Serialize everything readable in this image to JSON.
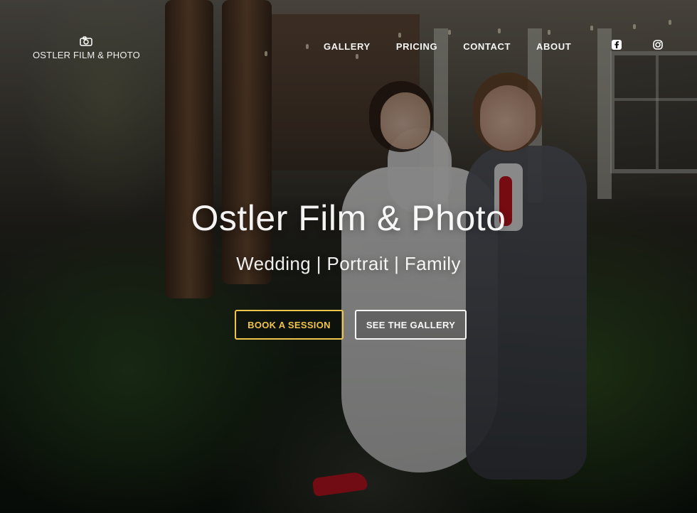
{
  "header": {
    "brand": {
      "icon": "camera-icon",
      "label": "OSTLER FILM & PHOTO"
    },
    "nav": [
      {
        "label": "GALLERY"
      },
      {
        "label": "PRICING"
      },
      {
        "label": "CONTACT"
      },
      {
        "label": "ABOUT"
      }
    ],
    "social": [
      {
        "icon": "facebook-icon"
      },
      {
        "icon": "instagram-icon"
      }
    ]
  },
  "hero": {
    "title": "Ostler Film & Photo",
    "subtitle": "Wedding | Portrait | Family",
    "buttons": {
      "book": "BOOK A SESSION",
      "gallery": "SEE THE GALLERY"
    }
  },
  "colors": {
    "accent": "#f0c34a",
    "text": "#ffffff"
  }
}
